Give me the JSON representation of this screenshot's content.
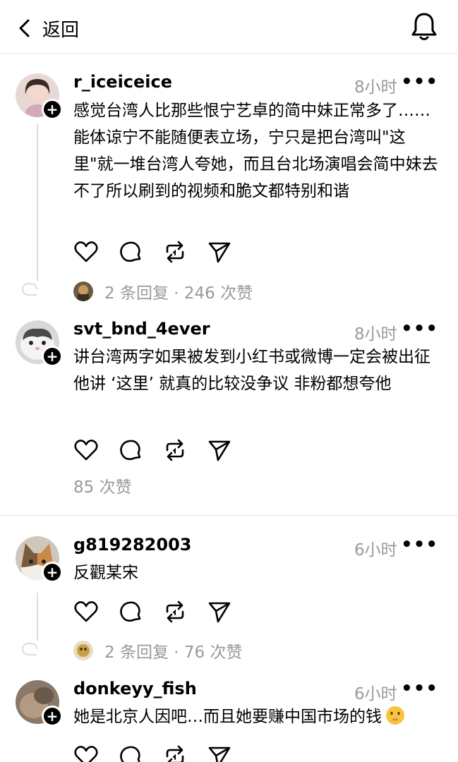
{
  "header": {
    "back_label": "返回"
  },
  "posts": [
    {
      "username": "r_iceiceice",
      "time": "8小时",
      "text": "感觉台湾人比那些恨宁艺卓的简中妹正常多了……能体谅宁不能随便表立场，宁只是把台湾叫\"这里\"就一堆台湾人夸她，而且台北场演唱会简中妹去不了所以刷到的视频和脆文都特别和谐",
      "meta": "2 条回复 · 246 次赞"
    },
    {
      "username": "svt_bnd_4ever",
      "time": "8小时",
      "text": "讲台湾两字如果被发到小红书或微博一定会被出征 他讲 ‘这里’ 就真的比较没争议 非粉都想夸他",
      "meta": "85 次赞"
    },
    {
      "username": "g819282003",
      "time": "6小时",
      "text": "反觀某宋",
      "meta": "2 条回复 · 76 次赞"
    },
    {
      "username": "donkeyy_fish",
      "time": "6小时",
      "text": "她是北京人因吧…而且她要赚中国市场的钱",
      "emoji": "shushing-face-emoji"
    }
  ],
  "more_label": "•••",
  "plus_label": "+",
  "colors": {
    "secondary_text": "#999999",
    "divider": "#e6e6e6",
    "thread_line": "#dddddd"
  }
}
